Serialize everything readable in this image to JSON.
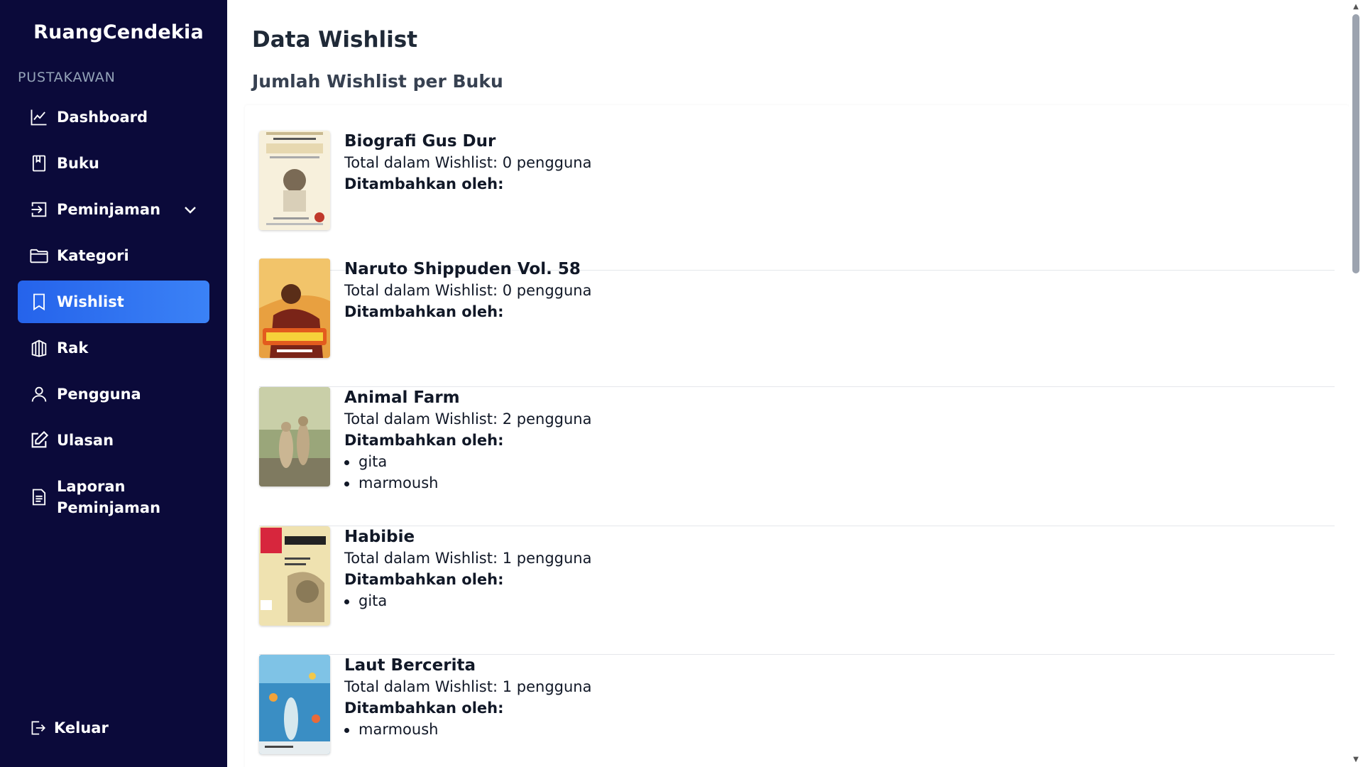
{
  "brand": "RuangCendekia",
  "sidebar": {
    "section_label": "PUSTAKAWAN",
    "items": [
      {
        "label": "Dashboard",
        "icon": "chart-line-icon"
      },
      {
        "label": "Buku",
        "icon": "book-icon"
      },
      {
        "label": "Peminjaman",
        "icon": "login-arrow-icon"
      },
      {
        "label": "Kategori",
        "icon": "folder-icon"
      },
      {
        "label": "Wishlist",
        "icon": "bookmark-icon"
      },
      {
        "label": "Rak",
        "icon": "bookshelf-icon"
      },
      {
        "label": "Pengguna",
        "icon": "user-icon"
      },
      {
        "label": "Ulasan",
        "icon": "edit-icon"
      },
      {
        "label": "Laporan Peminjaman",
        "icon": "document-icon"
      }
    ],
    "logout_label": "Keluar"
  },
  "main": {
    "page_title": "Data Wishlist",
    "section_title": "Jumlah Wishlist per Buku",
    "books": [
      {
        "title": "Biografi Gus Dur",
        "total": "Total dalam Wishlist: 0 pengguna",
        "added_by_label": "Ditambahkan oleh:",
        "users": []
      },
      {
        "title": "Naruto Shippuden Vol. 58",
        "total": "Total dalam Wishlist: 0 pengguna",
        "added_by_label": "Ditambahkan oleh:",
        "users": []
      },
      {
        "title": "Animal Farm",
        "total": "Total dalam Wishlist: 2 pengguna",
        "added_by_label": "Ditambahkan oleh:",
        "users": [
          "gita",
          "marmoush"
        ]
      },
      {
        "title": "Habibie",
        "total": "Total dalam Wishlist: 1 pengguna",
        "added_by_label": "Ditambahkan oleh:",
        "users": [
          "gita"
        ]
      },
      {
        "title": "Laut Bercerita",
        "total": "Total dalam Wishlist: 1 pengguna",
        "added_by_label": "Ditambahkan oleh:",
        "users": [
          "marmoush"
        ]
      }
    ]
  },
  "colors": {
    "sidebar_bg": "#0b0a3a",
    "active_item": "#3b82f6"
  }
}
